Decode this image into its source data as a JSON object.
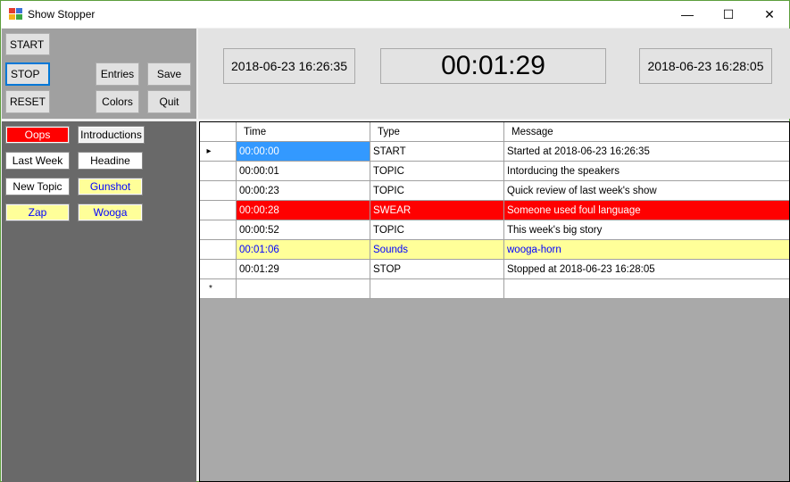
{
  "window": {
    "title": "Show Stopper",
    "minimize_glyph": "—",
    "maximize_glyph": "☐",
    "close_glyph": "✕"
  },
  "controls": {
    "start_label": "START",
    "stop_label": "STOP",
    "reset_label": "RESET",
    "entries_label": "Entries",
    "save_label": "Save",
    "colors_label": "Colors",
    "quit_label": "Quit"
  },
  "clocks": {
    "start_time": "2018-06-23 16:26:35",
    "elapsed": "00:01:29",
    "end_time": "2018-06-23 16:28:05"
  },
  "cue_buttons": [
    {
      "label": "Oops",
      "bg": "#ff0000",
      "fg": "#ffffff"
    },
    {
      "label": "Introductions",
      "bg": "#f0f0f0",
      "fg": "#000000"
    },
    {
      "label": "Last Week",
      "bg": "#ffffff",
      "fg": "#000000"
    },
    {
      "label": "Headine",
      "bg": "#ffffff",
      "fg": "#000000"
    },
    {
      "label": "New Topic",
      "bg": "#ffffff",
      "fg": "#000000"
    },
    {
      "label": "Gunshot",
      "bg": "#ffff99",
      "fg": "#0000ff"
    },
    {
      "label": "Zap",
      "bg": "#ffff99",
      "fg": "#0000ff"
    },
    {
      "label": "Wooga",
      "bg": "#ffff99",
      "fg": "#0000ff"
    }
  ],
  "grid": {
    "columns": [
      "Time",
      "Type",
      "Message"
    ],
    "rows": [
      {
        "time": "00:00:00",
        "type": "START",
        "message": "Started at 2018-06-23 16:26:35",
        "bg": "#ffffff",
        "fg": "#000000",
        "selected": true
      },
      {
        "time": "00:00:01",
        "type": "TOPIC",
        "message": "Intorducing the speakers",
        "bg": "#ffffff",
        "fg": "#000000",
        "selected": false
      },
      {
        "time": "00:00:23",
        "type": "TOPIC",
        "message": "Quick review of last week's show",
        "bg": "#ffffff",
        "fg": "#000000",
        "selected": false
      },
      {
        "time": "00:00:28",
        "type": "SWEAR",
        "message": "Someone used foul language",
        "bg": "#ff0000",
        "fg": "#ffffff",
        "selected": false
      },
      {
        "time": "00:00:52",
        "type": "TOPIC",
        "message": "This week's big story",
        "bg": "#ffffff",
        "fg": "#000000",
        "selected": false
      },
      {
        "time": "00:01:06",
        "type": "Sounds",
        "message": "wooga-horn",
        "bg": "#ffff99",
        "fg": "#0000ff",
        "selected": false
      },
      {
        "time": "00:01:29",
        "type": "STOP",
        "message": "Stopped at 2018-06-23 16:28:05",
        "bg": "#ffffff",
        "fg": "#000000",
        "selected": false
      }
    ],
    "current_row_glyph": "▸",
    "new_row_glyph": "*",
    "selection_color": "#3399ff"
  }
}
